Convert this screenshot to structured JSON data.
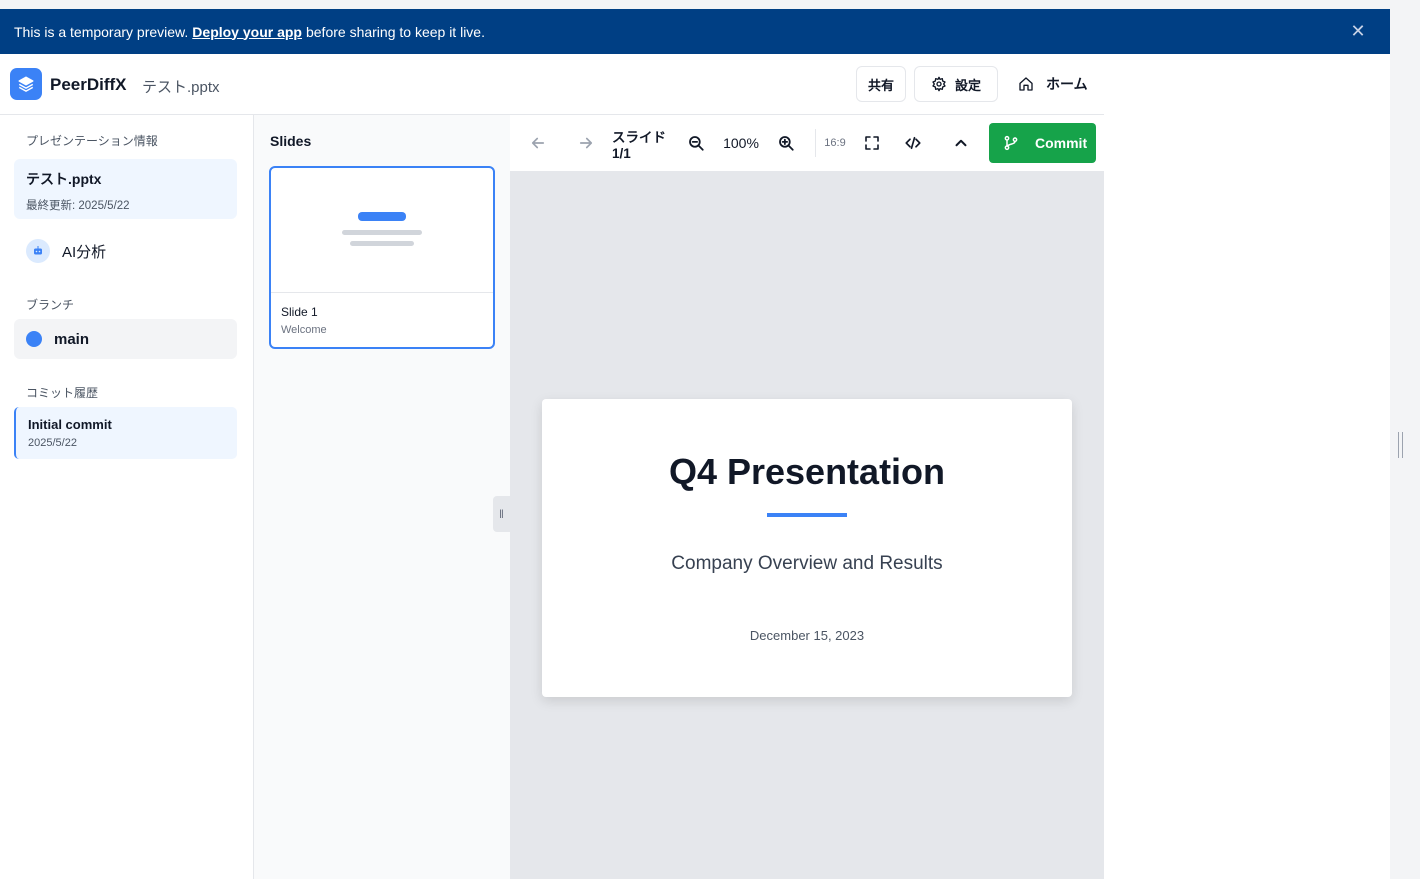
{
  "banner": {
    "prefix": "This is a temporary preview.",
    "link": "Deploy your app",
    "suffix": "before sharing to keep it live."
  },
  "header": {
    "app_name": "PeerDiffX",
    "file_name": "テスト.pptx",
    "share_label": "共有",
    "settings_label": "設定",
    "home_label": "ホーム"
  },
  "sidebar": {
    "presentation_info_label": "プレゼンテーション情報",
    "file_name": "テスト.pptx",
    "last_updated": "最終更新: 2025/5/22",
    "ai_label": "AI分析",
    "branch_label": "ブランチ",
    "branch_name": "main",
    "commit_history_label": "コミット履歴",
    "commit_message": "Initial commit",
    "commit_date": "2025/5/22"
  },
  "slides_panel": {
    "title": "Slides",
    "items": [
      {
        "title": "Slide 1",
        "subtitle": "Welcome"
      }
    ]
  },
  "toolbar": {
    "slide_counter": "スライド 1/1",
    "zoom": "100%",
    "aspect": "16:9",
    "commit_label": "Commit"
  },
  "slide": {
    "title": "Q4 Presentation",
    "subtitle": "Company Overview and Results",
    "date": "December 15, 2023"
  },
  "colors": {
    "banner": "#003f84",
    "accent": "#3b82f6",
    "commit": "#16a34a"
  }
}
